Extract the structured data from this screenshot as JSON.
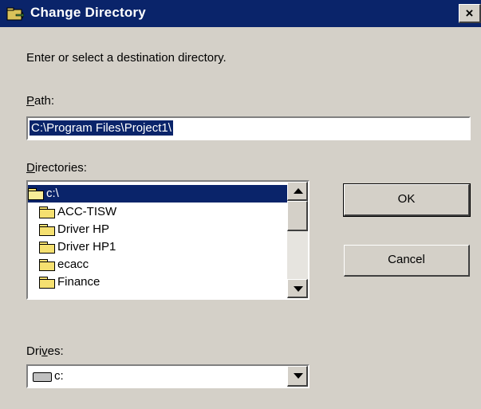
{
  "window": {
    "title": "Change Directory",
    "close_glyph": "×",
    "title_icon": "folder-move-icon"
  },
  "instruction": "Enter or select a destination directory.",
  "path": {
    "label": "Path:",
    "label_access_key": "P",
    "label_rest": "ath:",
    "value": "C:\\Program Files\\Project1\\"
  },
  "directories": {
    "label_access_key": "D",
    "label_rest": "irectories:",
    "items": [
      {
        "label": "c:\\",
        "icon": "open-folder-icon",
        "selected": true
      },
      {
        "label": "ACC-TISW",
        "icon": "folder-icon"
      },
      {
        "label": "Driver HP",
        "icon": "folder-icon"
      },
      {
        "label": "Driver HP1",
        "icon": "folder-icon"
      },
      {
        "label": "ecacc",
        "icon": "folder-icon"
      },
      {
        "label": "Finance",
        "icon": "folder-icon"
      }
    ]
  },
  "buttons": {
    "ok": "OK",
    "cancel": "Cancel"
  },
  "drives": {
    "label_before": "Dri",
    "label_access_key": "v",
    "label_after": "es:",
    "selected": "c:",
    "icon": "drive-icon"
  },
  "colors": {
    "title_bar": "#0a246a",
    "dialog_face": "#d4d0c8",
    "selection": "#0a246a"
  }
}
